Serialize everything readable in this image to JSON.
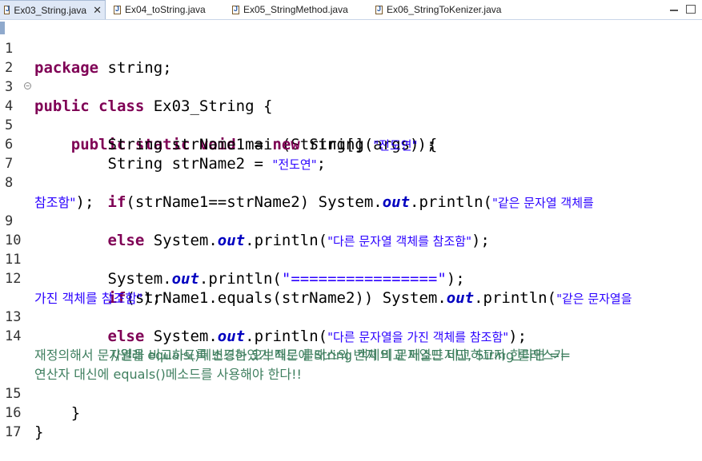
{
  "tabs": [
    {
      "label": "Ex03_String.java",
      "active": true,
      "closable": true
    },
    {
      "label": "Ex04_toString.java",
      "active": false
    },
    {
      "label": "Ex05_StringMethod.java",
      "active": false
    },
    {
      "label": "Ex06_StringToKenizer.java",
      "active": false
    }
  ],
  "window_controls": {
    "minimize_icon": "minimize-icon",
    "maximize_icon": "maximize-icon"
  },
  "line_numbers": [
    "1",
    "2",
    "3",
    "4",
    "5",
    "6",
    "7",
    "8",
    "9",
    "10",
    "11",
    "12",
    "13",
    "14",
    "15",
    "16",
    "17"
  ],
  "code": {
    "l1_kw": "package",
    "l1_rest": " string;",
    "l3_kw1": "public",
    "l3_kw2": "class",
    "l3_rest": " Ex03_String {",
    "l4_indent": "    ",
    "l4_kw1": "public",
    "l4_kw2": "static",
    "l4_kw3": "void",
    "l4_rest": " main(String[] args) {",
    "l5_a": "        String strName1 = ",
    "l5_kw": "new",
    "l5_b": " String(",
    "l5_str": "\"전도연\"",
    "l5_c": ");",
    "l6_a": "        String strName2 = ",
    "l6_str": "\"전도연\"",
    "l6_c": ";",
    "l8_kw": "if",
    "l8_a": "(strName1==strName2) System.",
    "l8_fld": "out",
    "l8_b": ".println(",
    "l8_str1": "\"같은 문자열 객체를",
    "l8_str2": "참조함\"",
    "l8_c": ");",
    "l9_kw": "else",
    "l9_a": " System.",
    "l9_fld": "out",
    "l9_b": ".println(",
    "l9_str": "\"다른 문자열 객체를 참조함\"",
    "l9_c": ");",
    "l11_a": "        System.",
    "l11_fld": "out",
    "l11_b": ".println(",
    "l11_str": "\"================\"",
    "l11_c": ");",
    "l12_kw": "if",
    "l12_a": "(strName1.equals(strName2)) System.",
    "l12_fld": "out",
    "l12_b": ".println(",
    "l12_str1": "\"같은 문자열을",
    "l12_str2": "가진 객체를 참조함\"",
    "l12_c": ");",
    "l13_kw": "else",
    "l13_a": " System.",
    "l13_fld": "out",
    "l13_b": ".println(",
    "l13_str": "\"다른 문자열을 가진 객체를 참조함\"",
    "l13_c": ");",
    "l14_c1": "//원래 equals()메소드는 오브젝트 클래스의 번지 비교 메소드지만, String 클래스가",
    "l14_c2": "재정의해서 문자열을 비교하도록 변경하였기 때문에 String 객체의 문자열만 비교하고자 한다면 ==",
    "l14_c3": "연산자 대신에 equals()메소드를 사용해야 한다!!",
    "l15": "    }",
    "l16": "}"
  },
  "colors": {
    "keyword": "#7f0055",
    "string": "#2a00ff",
    "field": "#0000c0",
    "comment": "#3f7f5f"
  }
}
